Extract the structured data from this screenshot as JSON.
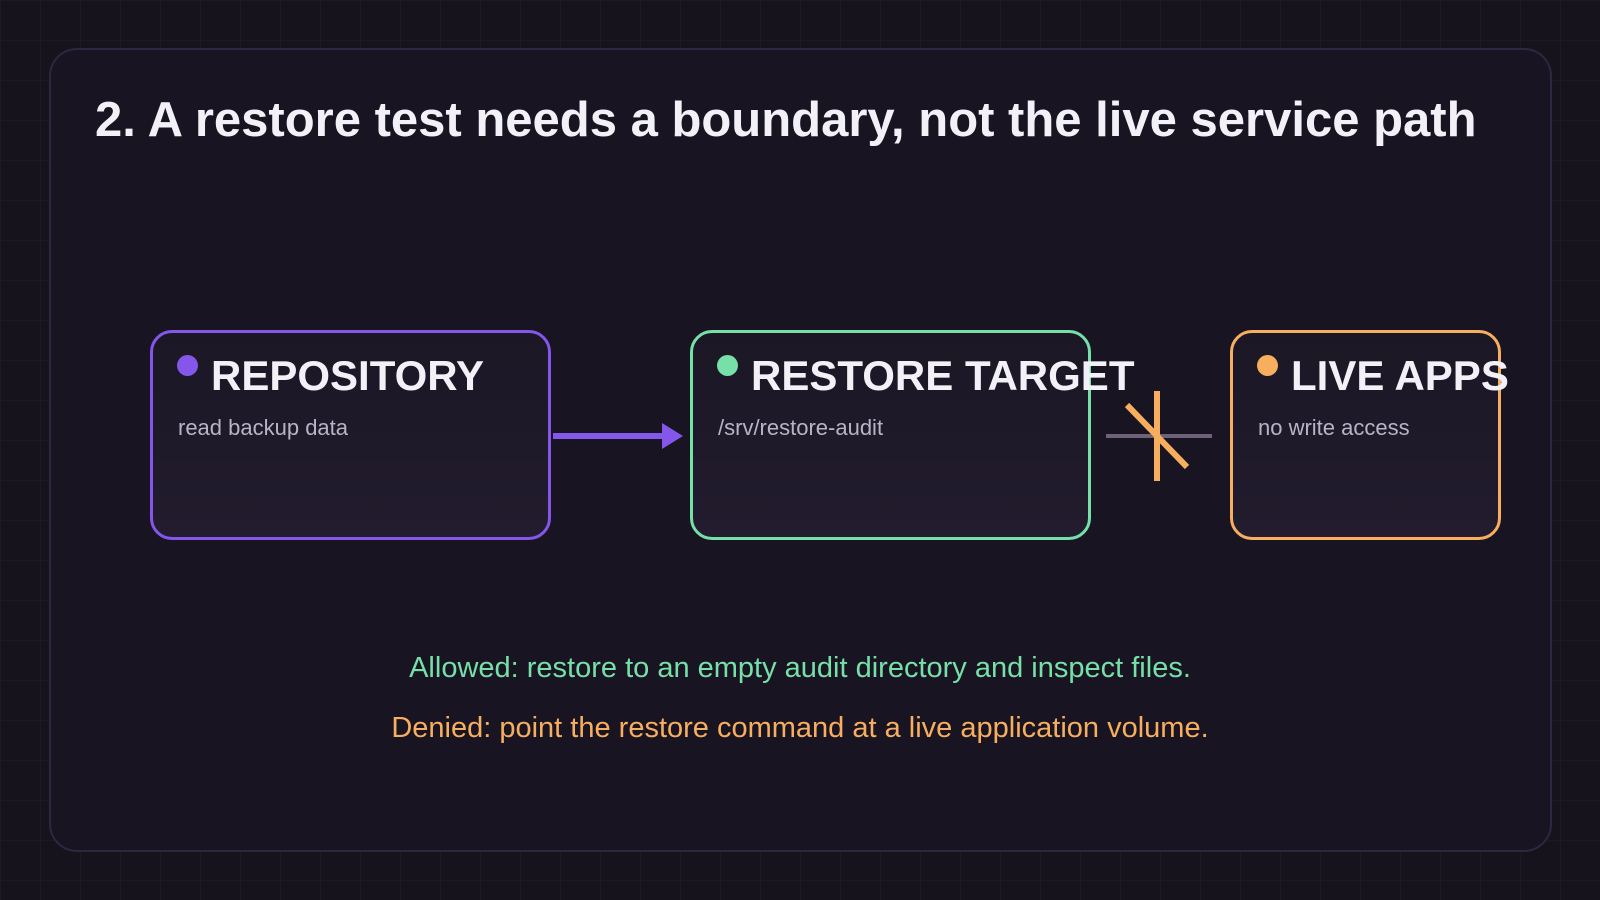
{
  "title": "2. A restore test needs a boundary, not the live service path",
  "nodes": {
    "repository": {
      "title": "REPOSITORY",
      "subtitle": "read backup data",
      "color": "#8457ea"
    },
    "restore_target": {
      "title": "RESTORE TARGET",
      "subtitle": "/srv/restore-audit",
      "color": "#77dfa8"
    },
    "live_apps": {
      "title": "LIVE APPS",
      "subtitle": "no write access",
      "color": "#f7ae5f"
    }
  },
  "connections": [
    {
      "from": "REPOSITORY",
      "to": "RESTORE TARGET",
      "kind": "allowed-arrow",
      "color": "#8457ea"
    },
    {
      "from": "RESTORE TARGET",
      "to": "LIVE APPS",
      "kind": "blocked",
      "color": "#f7ae5f"
    }
  ],
  "notes": {
    "allowed": "Allowed: restore to an empty audit directory and inspect files.",
    "denied": "Denied: point the restore command at a live application volume."
  },
  "colors": {
    "background": "#16131d",
    "panel": "#181422",
    "panel_border": "#2d2840",
    "text": "#f3f1f8",
    "muted_text": "#b9b3c8"
  }
}
